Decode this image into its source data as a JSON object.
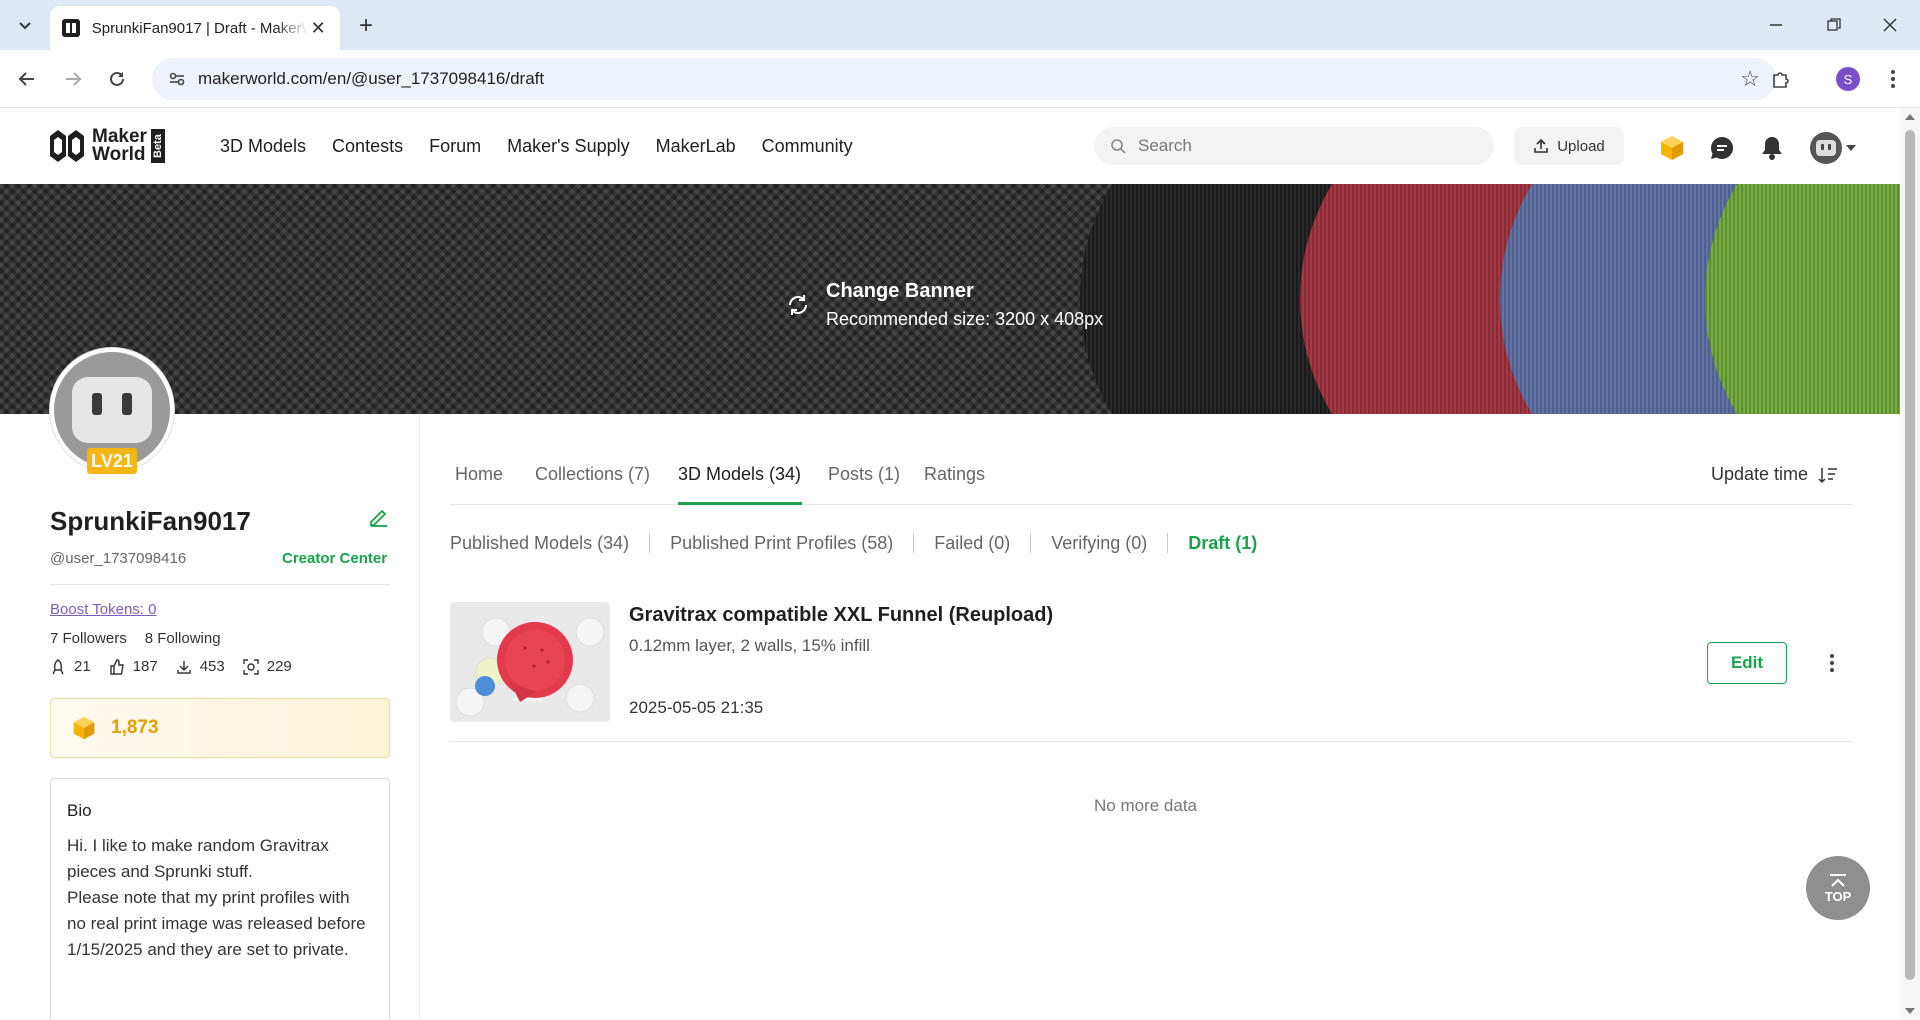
{
  "browser": {
    "tab_title": "SprunkiFan9017 | Draft - MakerWorld",
    "url": "makerworld.com/en/@user_1737098416/draft",
    "profile_initial": "S"
  },
  "header": {
    "logo_line1": "Maker",
    "logo_line2": "World",
    "logo_beta": "Beta",
    "nav": [
      "3D Models",
      "Contests",
      "Forum",
      "Maker's Supply",
      "MakerLab",
      "Community"
    ],
    "search_placeholder": "Search",
    "upload_label": "Upload"
  },
  "banner": {
    "change_label": "Change Banner",
    "recommended": "Recommended size: 3200 x 408px"
  },
  "profile": {
    "level": "LV21",
    "username": "SprunkiFan9017",
    "handle": "@user_1737098416",
    "creator_center": "Creator Center",
    "boost_tokens": "Boost Tokens: 0",
    "followers": "7 Followers",
    "following": "8 Following",
    "stats": {
      "boosts": "21",
      "likes": "187",
      "downloads": "453",
      "prints": "229"
    },
    "points": "1,873",
    "bio_heading": "Bio",
    "bio_text": "Hi. I like to make random Gravitrax pieces and Sprunki stuff.\nPlease note that my print profiles with no real print image was released before 1/15/2025 and they are set to private."
  },
  "tabs": {
    "items": [
      "Home",
      "Collections (7)",
      "3D Models (34)",
      "Posts (1)",
      "Ratings"
    ],
    "active": "3D Models (34)",
    "sort_label": "Update time"
  },
  "subtabs": {
    "items": [
      "Published Models (34)",
      "Published Print Profiles (58)",
      "Failed (0)",
      "Verifying (0)",
      "Draft (1)"
    ],
    "active": "Draft (1)"
  },
  "drafts": [
    {
      "title": "Gravitrax compatible XXL Funnel (Reupload)",
      "details": "0.12mm layer, 2 walls, 15% infill",
      "date": "2025-05-05 21:35",
      "edit_label": "Edit"
    }
  ],
  "footer": {
    "no_more": "No more data",
    "top_label": "TOP"
  },
  "colors": {
    "accent_green": "#1aa34a",
    "points_gold": "#e1a100",
    "level_badge": "#f3b614"
  }
}
